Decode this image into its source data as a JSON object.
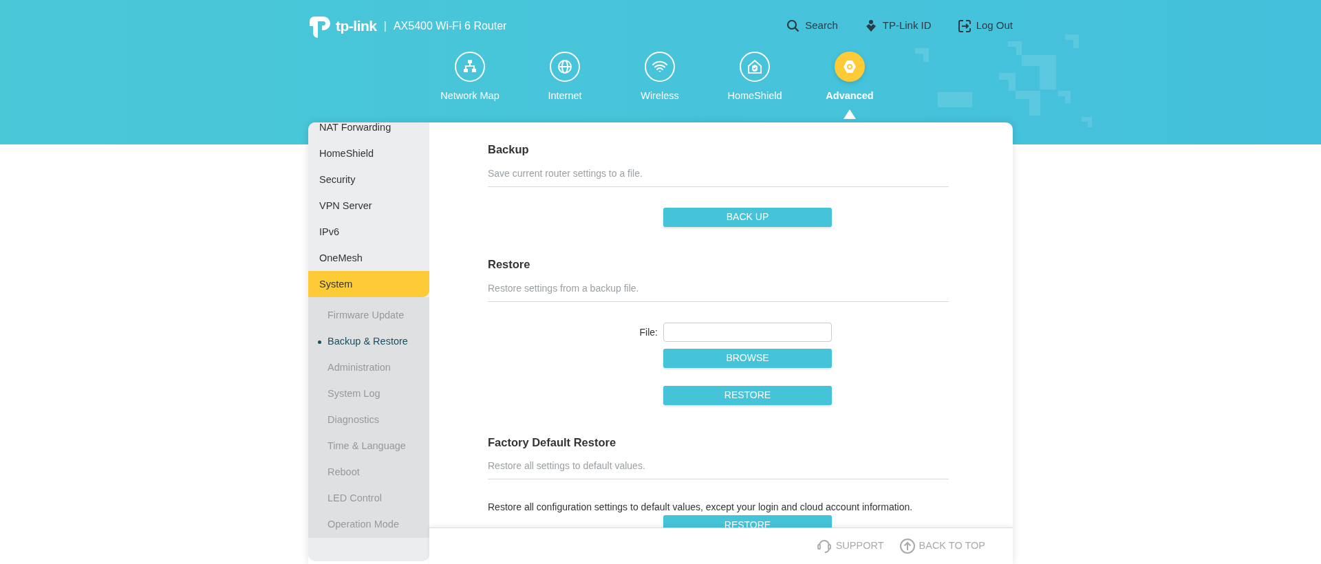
{
  "header": {
    "brand": "tp-link",
    "separator": "|",
    "model": "AX5400 Wi-Fi 6 Router",
    "links": [
      {
        "label": "Search",
        "kind": "search"
      },
      {
        "label": "TP-Link ID",
        "kind": "id"
      },
      {
        "label": "Log Out",
        "kind": "logout"
      }
    ]
  },
  "nav": [
    {
      "label": "Network Map",
      "kind": "network",
      "selected": false
    },
    {
      "label": "Internet",
      "kind": "internet",
      "selected": false
    },
    {
      "label": "Wireless",
      "kind": "wireless",
      "selected": false
    },
    {
      "label": "HomeShield",
      "kind": "homeshield",
      "selected": false
    },
    {
      "label": "Advanced",
      "kind": "advanced",
      "selected": true
    }
  ],
  "sidebar": {
    "items": [
      {
        "label": "NAT Forwarding",
        "selected": false
      },
      {
        "label": "HomeShield",
        "selected": false
      },
      {
        "label": "Security",
        "selected": false
      },
      {
        "label": "VPN Server",
        "selected": false
      },
      {
        "label": "IPv6",
        "selected": false
      },
      {
        "label": "OneMesh",
        "selected": false
      },
      {
        "label": "System",
        "selected": true,
        "expanded": true,
        "children": [
          {
            "label": "Firmware Update",
            "selected": false
          },
          {
            "label": "Backup & Restore",
            "selected": true
          },
          {
            "label": "Administration",
            "selected": false
          },
          {
            "label": "System Log",
            "selected": false
          },
          {
            "label": "Diagnostics",
            "selected": false
          },
          {
            "label": "Time & Language",
            "selected": false
          },
          {
            "label": "Reboot",
            "selected": false
          },
          {
            "label": "LED Control",
            "selected": false
          },
          {
            "label": "Operation Mode",
            "selected": false
          }
        ]
      }
    ]
  },
  "sections": [
    {
      "title": "Backup",
      "description": "Save current router settings to a file.",
      "controls": [
        {
          "kind": "button",
          "label": "BACK UP"
        }
      ]
    },
    {
      "title": "Restore",
      "description": "Restore settings from a backup file.",
      "controls": [
        {
          "kind": "file",
          "label": "File:"
        },
        {
          "kind": "button",
          "label": "BROWSE"
        },
        {
          "kind": "button",
          "label": "RESTORE"
        }
      ]
    },
    {
      "title": "Factory Default Restore",
      "description": "Restore all settings to default values.",
      "controls": [
        {
          "kind": "text",
          "text": "Restore all configuration settings to default values, except your login and cloud account information."
        },
        {
          "kind": "button",
          "label": "RESTORE"
        }
      ]
    }
  ],
  "footer": {
    "links": [
      {
        "label": "SUPPORT",
        "kind": "support"
      },
      {
        "label": "BACK TO TOP",
        "kind": "top"
      }
    ]
  }
}
